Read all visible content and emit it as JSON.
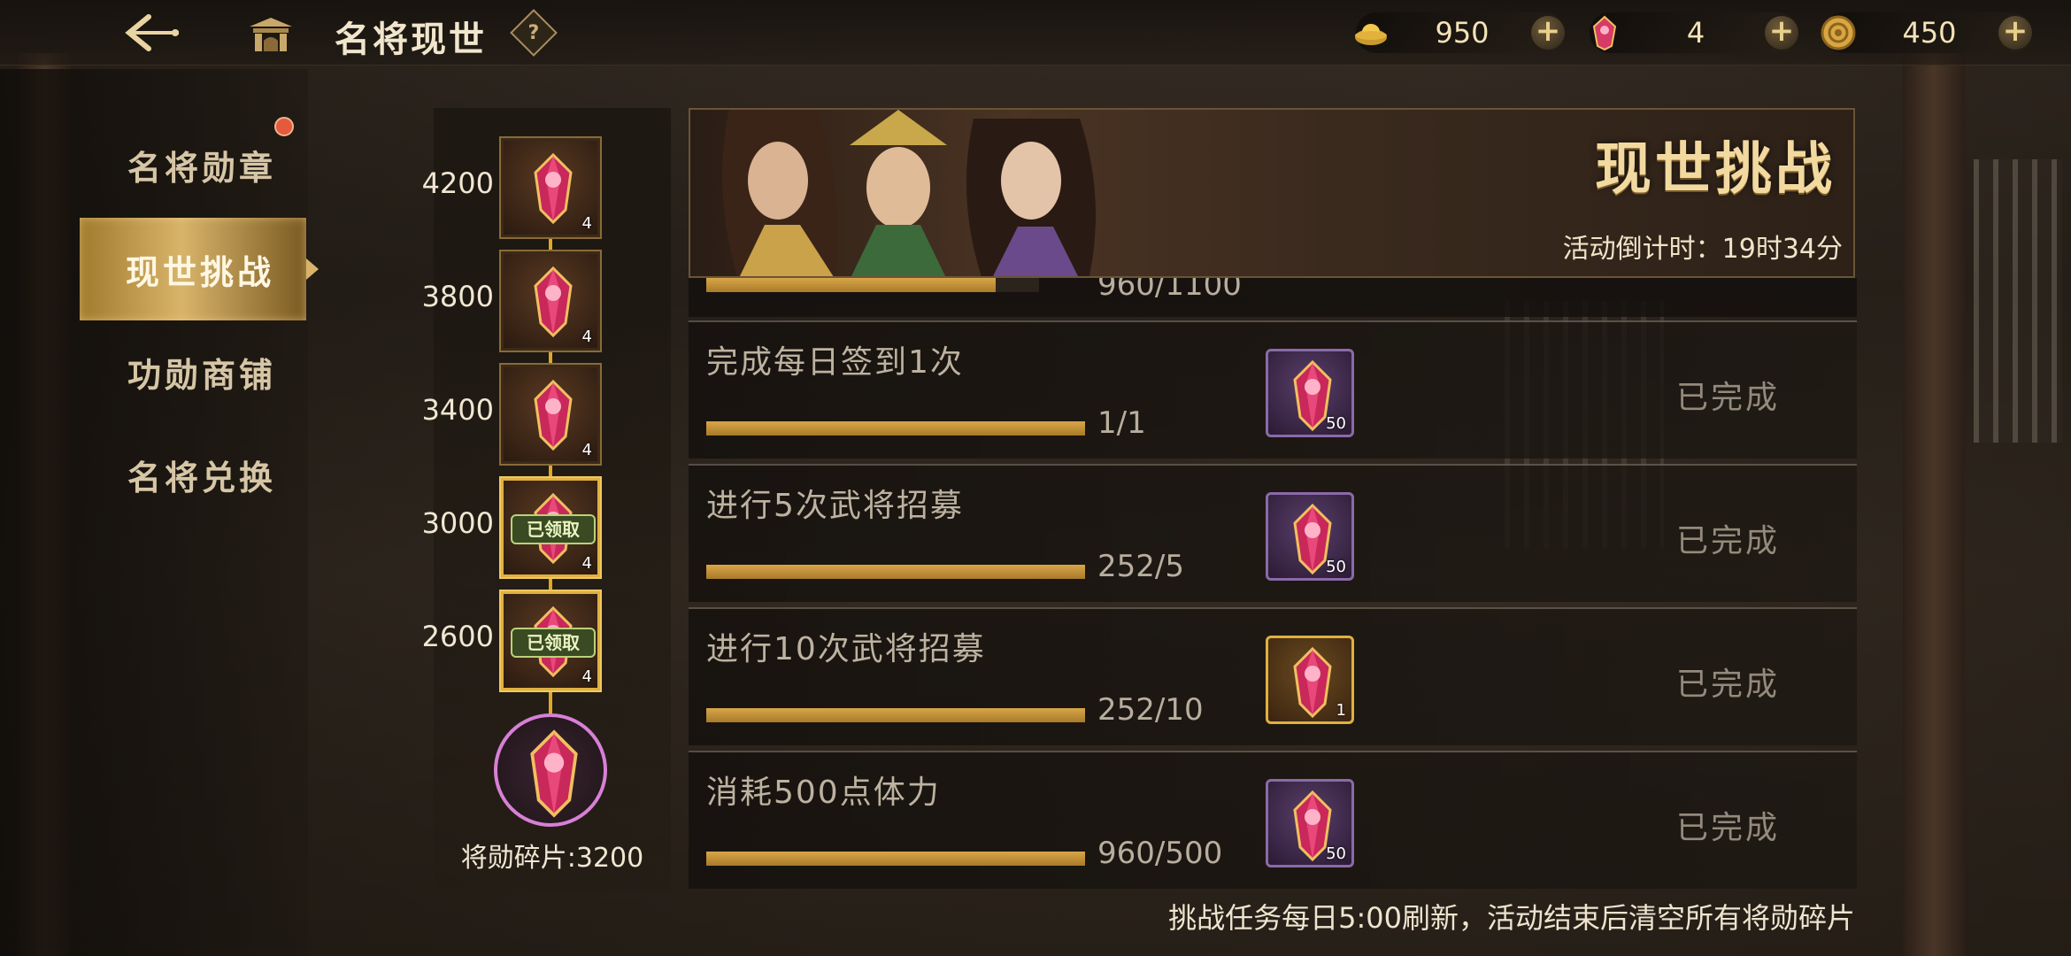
{
  "header": {
    "title": "名将现世",
    "help_symbol": "?",
    "currencies": [
      {
        "name": "gold-ingot",
        "value": "950",
        "color": "#f2c94c"
      },
      {
        "name": "crimson-gem",
        "value": "4",
        "color": "#e0466e"
      },
      {
        "name": "coin",
        "value": "450",
        "color": "#d9a640"
      }
    ],
    "plus_symbol": "+"
  },
  "nav": {
    "items": [
      {
        "label": "名将勋章"
      },
      {
        "label": "现世挑战"
      },
      {
        "label": "功勋商铺"
      },
      {
        "label": "名将兑换"
      }
    ],
    "active_index": 1
  },
  "milestones": {
    "tiers": [
      {
        "points": "4200",
        "count": "4",
        "claimed": false
      },
      {
        "points": "3800",
        "count": "4",
        "claimed": false
      },
      {
        "points": "3400",
        "count": "4",
        "claimed": false
      },
      {
        "points": "3000",
        "count": "4",
        "claimed": true
      },
      {
        "points": "2600",
        "count": "4",
        "claimed": true
      }
    ],
    "claimed_label": "已领取",
    "fragments_label": "将勋碎片:3200"
  },
  "banner": {
    "title": "现世挑战",
    "timer": "活动倒计时：19时34分"
  },
  "tasks": {
    "partial": {
      "progress": "960/1100",
      "fill": 0.87
    },
    "rows": [
      {
        "desc": "完成每日签到1次",
        "progress": "1/1",
        "fill": 1.0,
        "reward_count": "50",
        "reward_type": "purple",
        "status": "已完成"
      },
      {
        "desc": "进行5次武将招募",
        "progress": "252/5",
        "fill": 1.0,
        "reward_count": "50",
        "reward_type": "purple",
        "status": "已完成"
      },
      {
        "desc": "进行10次武将招募",
        "progress": "252/10",
        "fill": 1.0,
        "reward_count": "1",
        "reward_type": "gold",
        "status": "已完成"
      },
      {
        "desc": "消耗500点体力",
        "progress": "960/500",
        "fill": 1.0,
        "reward_count": "50",
        "reward_type": "purple",
        "status": "已完成"
      }
    ]
  },
  "footer": {
    "note": "挑战任务每日5:00刷新，活动结束后清空所有将勋碎片"
  }
}
